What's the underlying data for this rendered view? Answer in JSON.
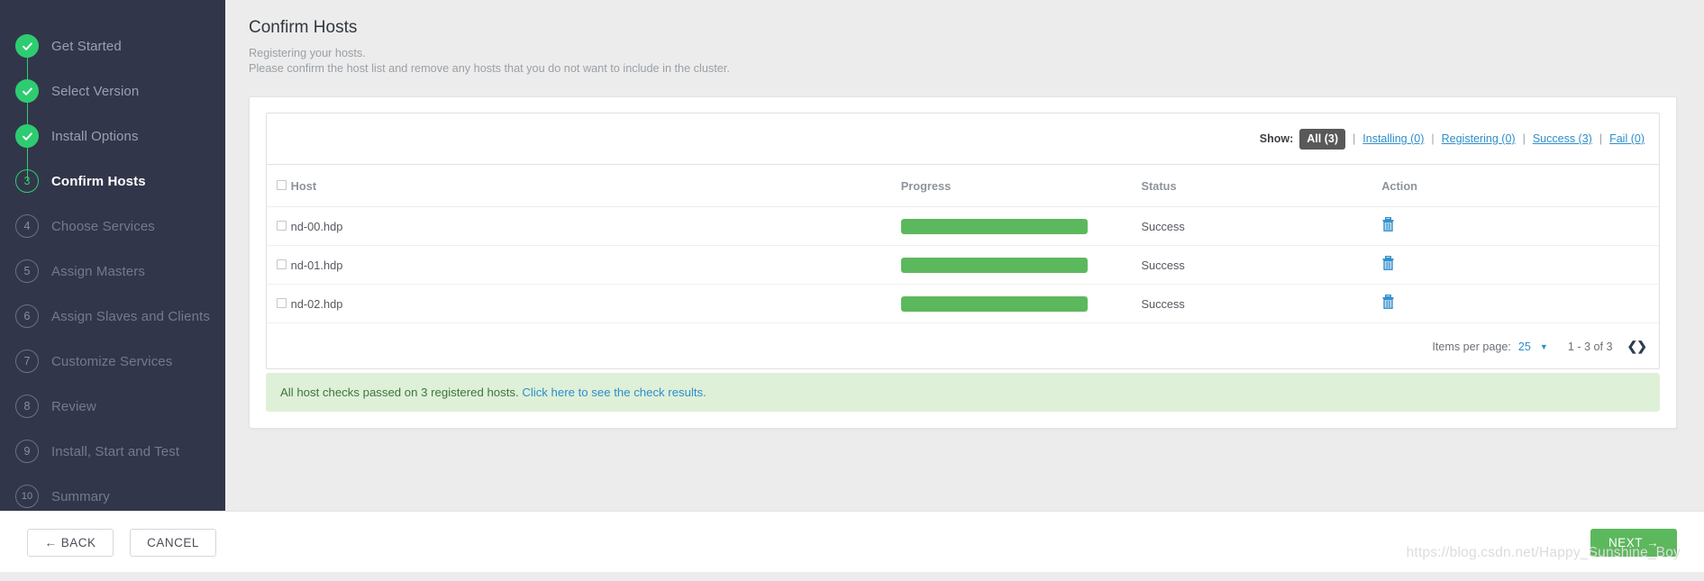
{
  "sidebar": {
    "steps": [
      {
        "num": "1",
        "label": "Get Started",
        "state": "done"
      },
      {
        "num": "2",
        "label": "Select Version",
        "state": "done"
      },
      {
        "num": "3",
        "label": "Install Options",
        "state": "done"
      },
      {
        "num": "3",
        "label": "Confirm Hosts",
        "state": "active"
      },
      {
        "num": "4",
        "label": "Choose Services",
        "state": "todo"
      },
      {
        "num": "5",
        "label": "Assign Masters",
        "state": "todo"
      },
      {
        "num": "6",
        "label": "Assign Slaves and Clients",
        "state": "todo"
      },
      {
        "num": "7",
        "label": "Customize Services",
        "state": "todo"
      },
      {
        "num": "8",
        "label": "Review",
        "state": "todo"
      },
      {
        "num": "9",
        "label": "Install, Start and Test",
        "state": "todo"
      },
      {
        "num": "10",
        "label": "Summary",
        "state": "todo"
      }
    ]
  },
  "main": {
    "title": "Confirm Hosts",
    "subtitle_line1": "Registering your hosts.",
    "subtitle_line2": "Please confirm the host list and remove any hosts that you do not want to include in the cluster."
  },
  "filters": {
    "show_label": "Show:",
    "separator": "|",
    "items": [
      {
        "label": "All (3)",
        "active": true
      },
      {
        "label": "Installing (0)",
        "active": false
      },
      {
        "label": "Registering (0)",
        "active": false
      },
      {
        "label": "Success (3)",
        "active": false
      },
      {
        "label": "Fail (0)",
        "active": false
      }
    ]
  },
  "table": {
    "columns": [
      "Host",
      "Progress",
      "Status",
      "Action"
    ],
    "rows": [
      {
        "host": "nd-00.hdp",
        "progress": 100,
        "status": "Success",
        "action_icon": "trash-icon"
      },
      {
        "host": "nd-01.hdp",
        "progress": 100,
        "status": "Success",
        "action_icon": "trash-icon"
      },
      {
        "host": "nd-02.hdp",
        "progress": 100,
        "status": "Success",
        "action_icon": "trash-icon"
      }
    ]
  },
  "pagination": {
    "items_per_page_label": "Items per page:",
    "items_per_page_value": "25",
    "caret_icon": "chevron-down-icon",
    "range": "1 - 3 of 3",
    "prev_icon": "chevron-left-icon",
    "next_icon": "chevron-right-icon"
  },
  "alert": {
    "message": "All host checks passed on 3 registered hosts.",
    "link": "Click here to see the check results."
  },
  "footer": {
    "back_label": "← BACK",
    "cancel_label": "CANCEL",
    "next_label": "NEXT →"
  },
  "watermark": "https://blog.csdn.net/Happy_Sunshine_Boy",
  "colors": {
    "sidebar_bg": "#32364a",
    "accent_green": "#2ecc71",
    "progress_green": "#5cb85c",
    "link_blue": "#2d8ecb",
    "alert_bg": "#dff0d8",
    "alert_text": "#3c763d",
    "chip_bg": "#595959"
  }
}
